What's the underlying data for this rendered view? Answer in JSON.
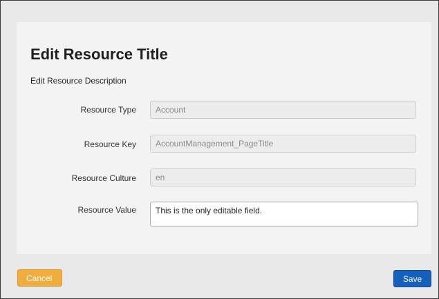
{
  "dialog": {
    "title": "Edit Resource Title",
    "description": "Edit Resource Description"
  },
  "fields": {
    "type": {
      "label": "Resource Type",
      "value": "Account"
    },
    "key": {
      "label": "Resource Key",
      "value": "AccountManagement_PageTitle"
    },
    "culture": {
      "label": "Resource Culture",
      "value": "en"
    },
    "value": {
      "label": "Resource Value",
      "value": "This is the only editable field."
    }
  },
  "buttons": {
    "cancel_label": "Cancel",
    "save_label": "Save"
  },
  "colors": {
    "cancel": "#f0ad3e",
    "save": "#1560bd"
  }
}
